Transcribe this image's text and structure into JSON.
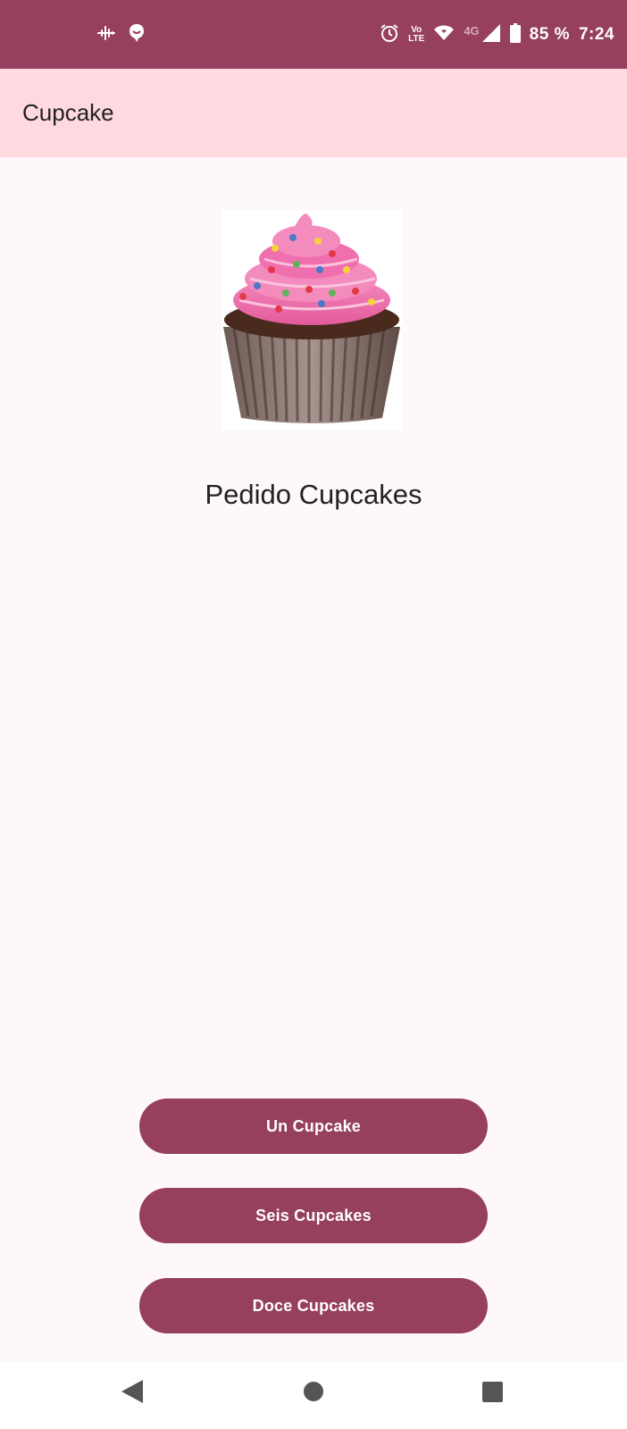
{
  "status_bar": {
    "battery": "85 %",
    "time": "7:24",
    "network_top": "Vo",
    "network_bottom": "LTE",
    "signal_type": "4G",
    "icons": [
      "audio-waveform-icon",
      "chat-notification-icon",
      "alarm-icon",
      "volte-icon",
      "wifi-icon",
      "cell-signal-icon",
      "battery-icon"
    ]
  },
  "app_bar": {
    "title": "Cupcake"
  },
  "hero": {
    "image": "cupcake-image",
    "title": "Pedido Cupcakes"
  },
  "buttons": {
    "one": "Un Cupcake",
    "six": "Seis Cupcakes",
    "twelve": "Doce Cupcakes"
  },
  "colors": {
    "primary": "#963f5f",
    "app_bar": "#ffd9e0",
    "background": "#fff8fb",
    "text": "#222222"
  }
}
